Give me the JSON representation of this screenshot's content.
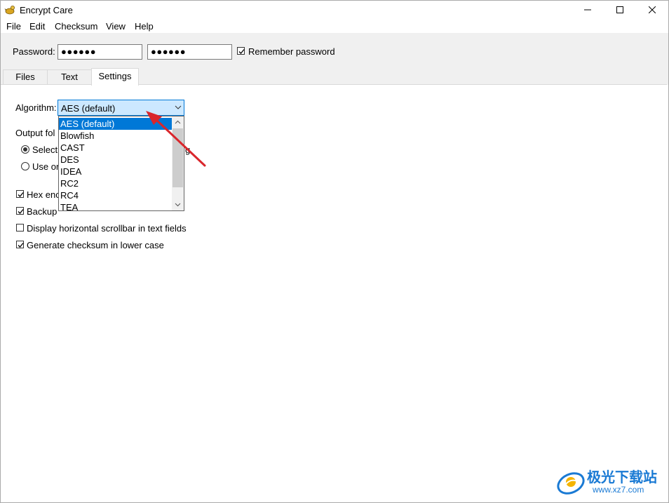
{
  "window": {
    "title": "Encrypt Care",
    "icon": "app-logo-icon"
  },
  "title_buttons": {
    "minimize": "minimize-icon",
    "maximize": "maximize-icon",
    "close": "close-icon"
  },
  "menu": {
    "items": [
      "File",
      "Edit",
      "Checksum",
      "View",
      "Help"
    ]
  },
  "password_bar": {
    "label": "Password:",
    "password_value": "●●●●●●",
    "confirm_value": "●●●●●●",
    "remember_label": "Remember password",
    "remember_checked": true
  },
  "tabs": [
    {
      "label": "Files",
      "active": false
    },
    {
      "label": "Text",
      "active": false
    },
    {
      "label": "Settings",
      "active": true
    }
  ],
  "settings": {
    "algorithm_label": "Algorithm:",
    "algorithm_selected": "AES (default)",
    "algorithm_options": [
      "AES (default)",
      "Blowfish",
      "CAST",
      "DES",
      "IDEA",
      "RC2",
      "RC4",
      "TEA"
    ],
    "output_folder_label": "Output fol",
    "radio_select_label": "Select",
    "radio_select_tail": "g",
    "radio_use_label": "Use or",
    "hex_label": "Hex enc",
    "backup_label": "Backup",
    "scrollbar_label": "Display horizontal scrollbar in text fields",
    "checksum_label": "Generate checksum in lower case"
  },
  "checks": {
    "hex": true,
    "backup": true,
    "scrollbar": false,
    "checksum": true
  },
  "watermark": {
    "text": "极光下载站",
    "url": "www.xz7.com"
  },
  "colors": {
    "accent": "#0078d7",
    "arrow": "#d9262c",
    "watermark": "#1a7ad4"
  }
}
